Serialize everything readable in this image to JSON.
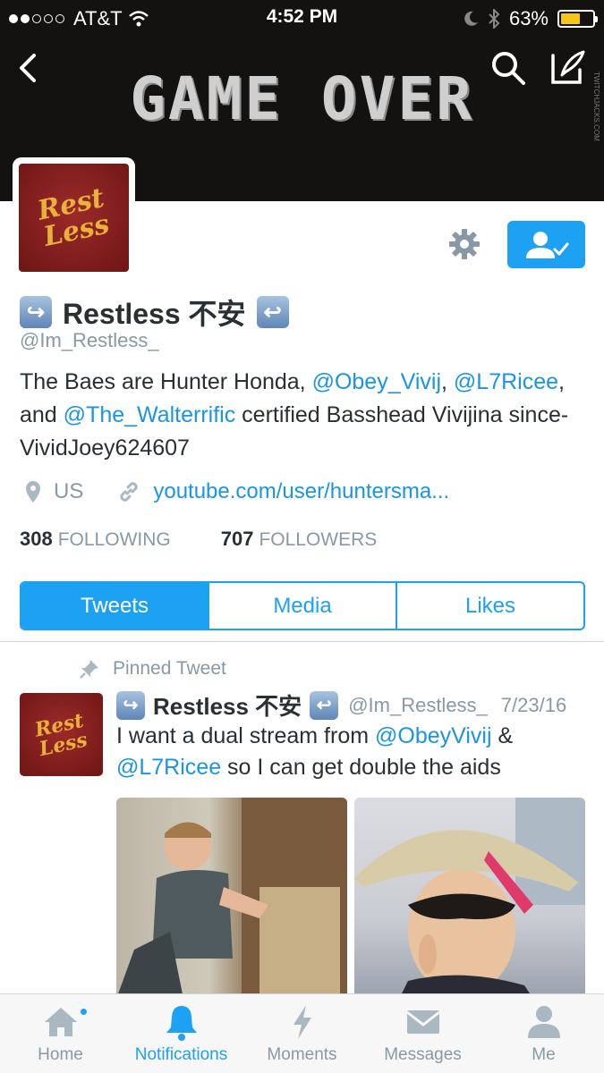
{
  "status_bar": {
    "carrier": "AT&T",
    "time": "4:52 PM",
    "battery": "63%",
    "battery_level": 0.63
  },
  "header": {
    "banner_title": "GAME OVER",
    "watermark": "TWITCHJACKS.COM"
  },
  "profile": {
    "name": "Restless 不安",
    "handle": "@Im_Restless_",
    "avatar_text": "Rest Less",
    "bio": {
      "part1": "The Baes are Hunter Honda, ",
      "mention1": "@Obey_Vivij",
      "part2": ",",
      "mention2": "@L7Ricee",
      "part3": ", and ",
      "mention3": "@The_Walterrific",
      "part4": " certified Basshead Vivijina since-VividJoey624607"
    },
    "location": "US",
    "url": "youtube.com/user/huntersma...",
    "following_count": "308",
    "following_label": "FOLLOWING",
    "followers_count": "707",
    "followers_label": "FOLLOWERS"
  },
  "tabs": [
    "Tweets",
    "Media",
    "Likes"
  ],
  "tweet": {
    "pinned_label": "Pinned Tweet",
    "name": "Restless 不安",
    "handle": "@Im_Restless_",
    "date": "7/23/16",
    "text1": "I want a dual stream from ",
    "mention1": "@ObeyVivij",
    "text2": " & ",
    "mention2": "@L7Ricee",
    "text3": " so I can get double the aids"
  },
  "tab_bar": {
    "items": [
      "Home",
      "Notifications",
      "Moments",
      "Messages",
      "Me"
    ],
    "active": "Notifications"
  },
  "colors": {
    "accent": "#1da1f2",
    "link": "#1b95e0",
    "muted": "#8899a6",
    "text": "#292f33",
    "avatar_bg": "#7d1c1c",
    "avatar_text": "#e8b13a"
  }
}
